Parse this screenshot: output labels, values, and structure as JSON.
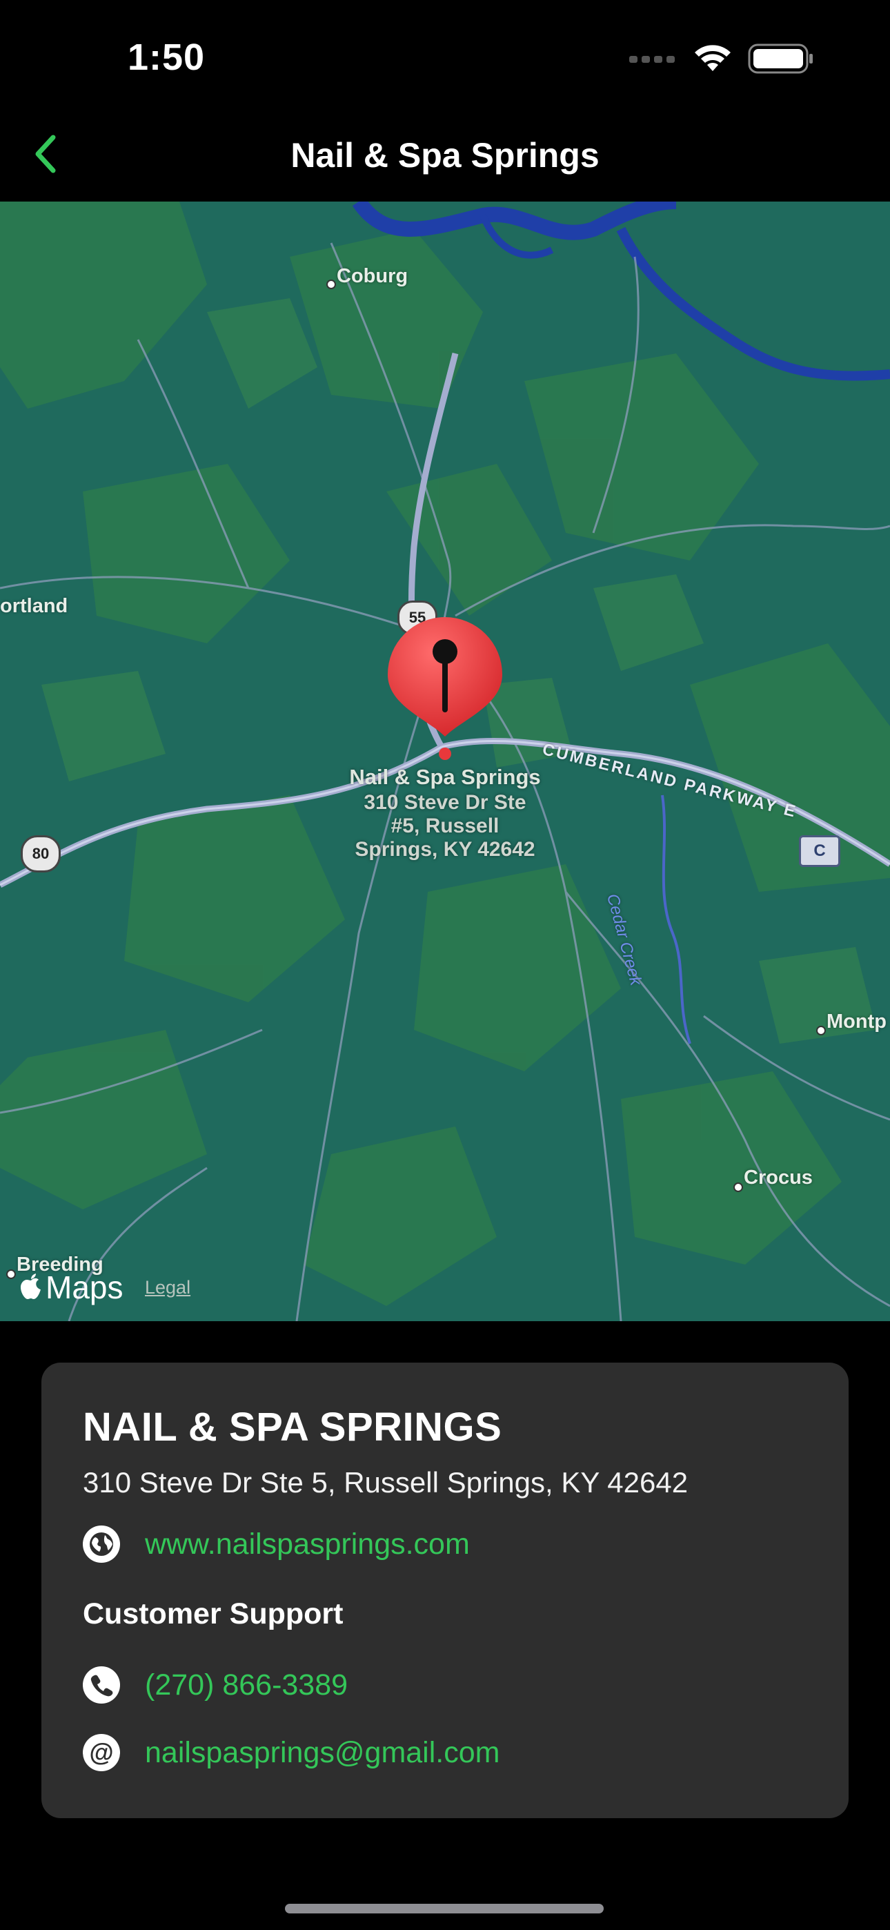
{
  "status_bar": {
    "time": "1:50",
    "icons": [
      "cellular-icon",
      "wifi-icon",
      "battery-icon"
    ]
  },
  "nav": {
    "title": "Nail & Spa Springs",
    "back_icon": "chevron-left-icon"
  },
  "map": {
    "places": {
      "coburg": "Coburg",
      "portland": "ortland",
      "montp": "Montp",
      "crocus": "Crocus",
      "breeding": "Breeding"
    },
    "road_labels": {
      "parkway": "CUMBERLAND PARKWAY E",
      "creek": "Cedar Creek"
    },
    "shields": {
      "r55": "55",
      "r80": "80",
      "c": "C"
    },
    "pin": {
      "name": "Nail & Spa Springs",
      "line1": "310 Steve Dr Ste",
      "line2": "#5, Russell",
      "line3": "Springs, KY 42642"
    },
    "attribution": {
      "logo": "Maps",
      "legal": "Legal"
    }
  },
  "card": {
    "title": "NAIL & SPA SPRINGS",
    "address": "310 Steve Dr Ste 5, Russell Springs, KY 42642",
    "website": "www.nailspasprings.com",
    "support_title": "Customer Support",
    "phone": "(270) 866-3389",
    "email": "nailspasprings@gmail.com"
  },
  "colors": {
    "accent": "#34c759",
    "card_bg": "#2e2e2e",
    "pin": "#e8383b",
    "map_bg": "#1f6a5d"
  }
}
